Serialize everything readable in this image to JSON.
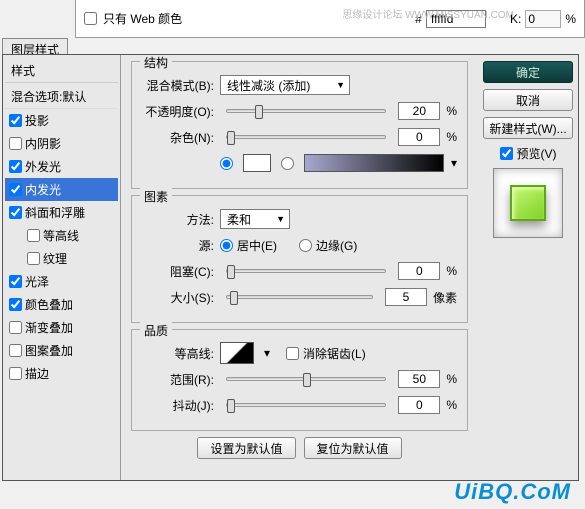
{
  "topbar": {
    "web_only": "只有 Web 颜色",
    "hash": "#",
    "hex": "fffffd",
    "k_label": "K:",
    "k_val": "0",
    "pct": "%",
    "wm": "思缘设计论坛  WWW.MISSYUAN.COM"
  },
  "tab": "图层样式",
  "sidebar": {
    "head": "样式",
    "sub": "混合选项:默认",
    "items": [
      {
        "label": "投影",
        "chk": true
      },
      {
        "label": "内阴影",
        "chk": false
      },
      {
        "label": "外发光",
        "chk": true
      },
      {
        "label": "内发光",
        "chk": true,
        "sel": true
      },
      {
        "label": "斜面和浮雕",
        "chk": true
      },
      {
        "label": "等高线",
        "chk": false,
        "indent": true
      },
      {
        "label": "纹理",
        "chk": false,
        "indent": true
      },
      {
        "label": "光泽",
        "chk": true
      },
      {
        "label": "颜色叠加",
        "chk": true
      },
      {
        "label": "渐变叠加",
        "chk": false
      },
      {
        "label": "图案叠加",
        "chk": false
      },
      {
        "label": "描边",
        "chk": false
      }
    ]
  },
  "g1": {
    "title": "结构",
    "blend_l": "混合模式(B):",
    "blend_v": "线性减淡 (添加)",
    "opac_l": "不透明度(O):",
    "opac_v": "20",
    "noise_l": "杂色(N):",
    "noise_v": "0",
    "pct": "%"
  },
  "g2": {
    "title": "图素",
    "method_l": "方法:",
    "method_v": "柔和",
    "src_l": "源:",
    "src_c": "居中(E)",
    "src_e": "边缘(G)",
    "choke_l": "阻塞(C):",
    "choke_v": "0",
    "size_l": "大小(S):",
    "size_v": "5",
    "pct": "%",
    "px": "像素"
  },
  "g3": {
    "title": "品质",
    "contour_l": "等高线:",
    "aa": "消除锯齿(L)",
    "range_l": "范围(R):",
    "range_v": "50",
    "jitter_l": "抖动(J):",
    "jitter_v": "0",
    "pct": "%"
  },
  "buttons": {
    "default": "设置为默认值",
    "reset": "复位为默认值"
  },
  "right": {
    "ok": "确定",
    "cancel": "取消",
    "newstyle": "新建样式(W)...",
    "preview": "预览(V)"
  },
  "logo": "UiBQ.CoM"
}
